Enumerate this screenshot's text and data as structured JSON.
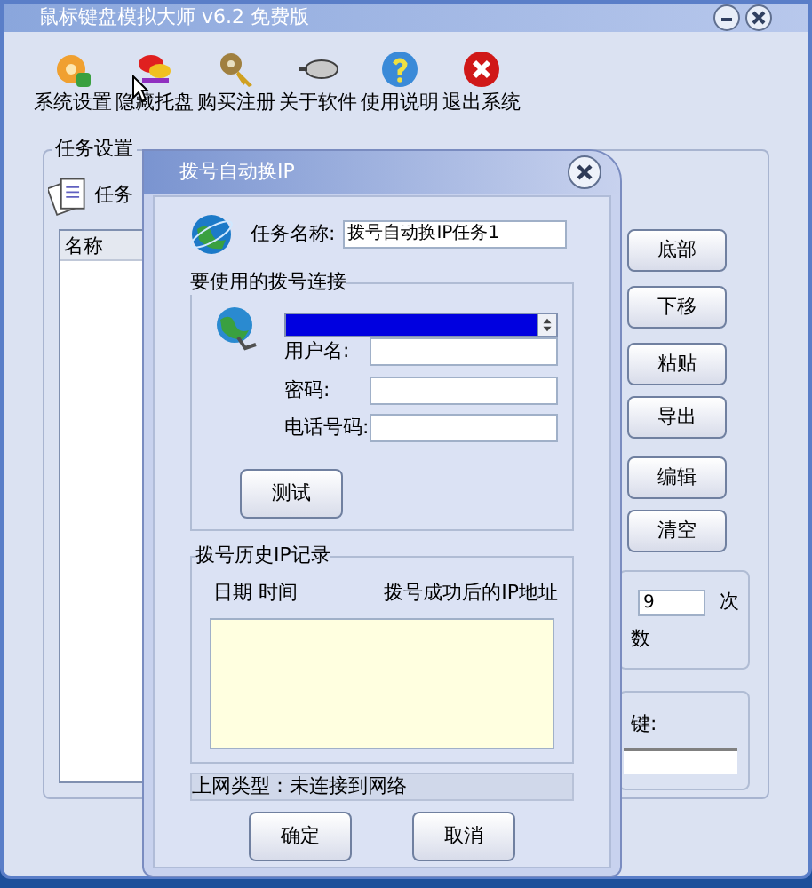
{
  "window": {
    "title": "鼠标键盘模拟大师 v6.2 免费版"
  },
  "toolbar": [
    {
      "label": "系统设置",
      "kind": "settings"
    },
    {
      "label": "隐藏托盘",
      "kind": "hide"
    },
    {
      "label": "购买注册",
      "kind": "register"
    },
    {
      "label": "关于软件",
      "kind": "about"
    },
    {
      "label": "使用说明",
      "kind": "help"
    },
    {
      "label": "退出系统",
      "kind": "exit"
    }
  ],
  "task_group": {
    "title": "任务设置",
    "caption": "任务",
    "list_columns": [
      "名称"
    ],
    "buttons": [
      "底部",
      "下移",
      "粘贴",
      "导出",
      "编辑",
      "清空"
    ],
    "repeat": {
      "value": "9",
      "unit": "次",
      "caption": "数"
    },
    "hotkey": {
      "label": "键:"
    }
  },
  "dialog": {
    "title": "拨号自动换IP",
    "task_name_label": "任务名称:",
    "task_name": "拨号自动换IP任务1",
    "connection_group": {
      "title": "要使用的拨号连接",
      "fields": [
        {
          "label": "用户名:"
        },
        {
          "label": "密码:"
        },
        {
          "label": "电话号码:"
        }
      ],
      "test_button": "测试"
    },
    "history_group": {
      "title": "拨号历史IP记录",
      "columns": [
        "日期 时间",
        "拨号成功后的IP地址"
      ]
    },
    "status": "上网类型：未连接到网络",
    "buttons": [
      "确定",
      "取消"
    ]
  }
}
